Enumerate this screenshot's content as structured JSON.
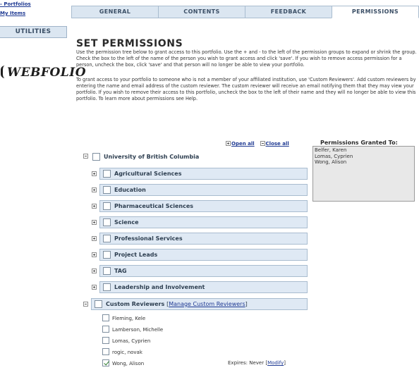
{
  "sidebar": {
    "links": [
      {
        "label": "- Portfolios"
      },
      {
        "label": "My Items"
      }
    ],
    "utilities_label": "UTILITIES",
    "logo_text": "WEBFOLIO"
  },
  "tabs": [
    {
      "label": "GENERAL",
      "active": false
    },
    {
      "label": "CONTENTS",
      "active": false
    },
    {
      "label": "FEEDBACK",
      "active": false
    },
    {
      "label": "PERMISSIONS",
      "active": true
    }
  ],
  "main": {
    "title": "SET PERMISSIONS",
    "paragraph1": "Use the permission tree below to grant access to this portfolio. Use the + and - to the left of the permission groups to expand or shrink the group. Check the box to the left of the name of the person you wish to grant access and click 'save'. If you wish to remove access permission for a person, uncheck the box, click 'save' and that person will no longer be able to view your portfolio.",
    "paragraph2": "To grant access to your portfolio to someone who is not a member of your affiliated institution, use 'Custom Reviewers'. Add custom reviewers by entering the name and email address of the custom reviewer. The custom reviewer will receive an email notifying them that they may view your portfolio. If you wish to remove their access to this portfolio, uncheck the box to the left of their name and they will no longer be able to view this portfolio. To learn more about permissions see Help.",
    "open_all": "Open all",
    "close_all": "Close all"
  },
  "tree": {
    "root": {
      "label": "University of British Columbia",
      "expanded": true,
      "checked": false
    },
    "groups": [
      {
        "label": "Agricultural Sciences",
        "checked": false
      },
      {
        "label": "Education",
        "checked": false
      },
      {
        "label": "Pharmaceutical Sciences",
        "checked": false
      },
      {
        "label": "Science",
        "checked": false
      },
      {
        "label": "Professional Services",
        "checked": false
      },
      {
        "label": "Project Leads",
        "checked": false
      },
      {
        "label": "TAG",
        "checked": false
      },
      {
        "label": "Leadership and Involvement",
        "checked": false
      }
    ],
    "custom": {
      "label": "Custom Reviewers",
      "manage_link": "Manage Custom Reviewers",
      "expanded": true,
      "checked": false,
      "reviewers": [
        {
          "name": "Fleming, Kele",
          "checked": false
        },
        {
          "name": "Lamberson, Michelle",
          "checked": false
        },
        {
          "name": "Lomas, Cyprien",
          "checked": false
        },
        {
          "name": "rogic, novak",
          "checked": false
        },
        {
          "name": "Wong, Alison",
          "checked": true
        }
      ],
      "expires_label": "Expires: Never",
      "modify_link": "Modify"
    }
  },
  "granted": {
    "title": "Permissions Granted To:",
    "names": [
      "Belfer, Karen",
      "Lomas, Cyprien",
      "Wong, Alison"
    ]
  }
}
